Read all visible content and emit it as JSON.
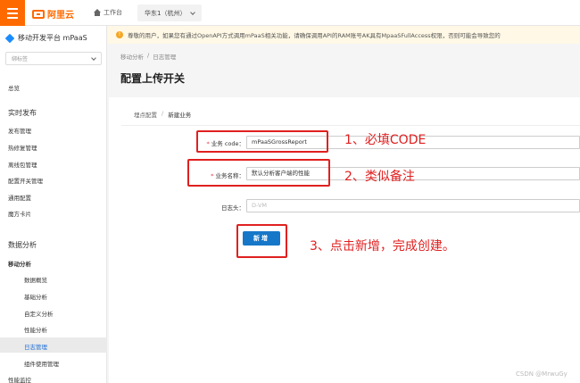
{
  "topbar": {
    "logo_text": "阿里云",
    "workbench_label": "工作台",
    "region_label": "华东1（杭州）"
  },
  "sidebar": {
    "platform_title": "移动开发平台 mPaaS",
    "tag_select_placeholder": "绑标签",
    "overview": "总览",
    "realtime_section": "实时发布",
    "realtime_items": [
      "发布管理",
      "热修复管理",
      "离线包管理",
      "配置开关管理",
      "通用配置",
      "魔方卡片"
    ],
    "data_section": "数据分析",
    "mobile_analysis": "移动分析",
    "mobile_items": [
      "数据概览",
      "基础分析",
      "自定义分析",
      "性能分析",
      "日志管理",
      "组件使用管理"
    ],
    "perf_monitor": "性能监控",
    "active_item": "日志管理"
  },
  "notice": {
    "text": "尊敬的用户，如果您有通过OpenAPI方式调用mPaaS相关功能，请确保调用API的RAM账号AK具有MpaaSFullAccess权限，否则可能会导致您的"
  },
  "breadcrumb": [
    "移动分析",
    "日志管理"
  ],
  "page_title": "配置上传开关",
  "card_breadcrumb": [
    "埋点配置",
    "新建业务"
  ],
  "form": {
    "business_code_label": "业务 code：",
    "business_code_value": "mPaaSGrossReport",
    "business_name_label": "业务名称：",
    "business_name_value": "默认分析客户端的性能",
    "log_header_label": "日志头：",
    "log_header_placeholder": "D-VM",
    "submit_label": "新增"
  },
  "annotations": {
    "step1": "1、必填CODE",
    "step2": "2、类似备注",
    "step3": "3、点击新增，完成创建。"
  },
  "watermark": "CSDN @MrwuGy",
  "colors": {
    "brand": "#ff6a00",
    "primary_button": "#1677c8",
    "annotation_red": "#e02020",
    "notice_bg": "#fff8e6"
  }
}
